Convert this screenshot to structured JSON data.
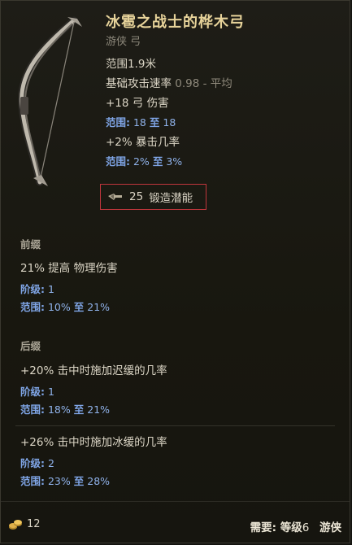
{
  "item": {
    "title": "冰雹之战士的桦木弓",
    "subtitle": "游侠 弓"
  },
  "stats": {
    "range": "范围1.9米",
    "speed_label": "基础攻击速率",
    "speed_value": "0.98 - 平均",
    "damage": "+18 弓 伤害",
    "damage_range": {
      "label": "范围:",
      "min": "18",
      "to": "至",
      "max": "18"
    },
    "crit": "+2% 暴击几率",
    "crit_range": {
      "label": "范围:",
      "min": "2%",
      "to": "至",
      "max": "3%"
    }
  },
  "forge": {
    "value": "25",
    "label": "锻造潜能",
    "icon": "forge-hammer-icon"
  },
  "prefix": {
    "header": "前缀",
    "affixes": [
      {
        "name": "21% 提高 物理伤害",
        "tier_label": "阶级:",
        "tier": "1",
        "range_label": "范围:",
        "min": "10%",
        "to": "至",
        "max": "21%"
      }
    ]
  },
  "suffix": {
    "header": "后缀",
    "affixes": [
      {
        "name": "+20% 击中时施加迟缓的几率",
        "tier_label": "阶级:",
        "tier": "1",
        "range_label": "范围:",
        "min": "18%",
        "to": "至",
        "max": "21%"
      },
      {
        "name": "+26% 击中时施加冰缓的几率",
        "tier_label": "阶级:",
        "tier": "2",
        "range_label": "范围:",
        "min": "23%",
        "to": "至",
        "max": "28%"
      }
    ]
  },
  "footer": {
    "gold": "12",
    "gold_icon": "gold-coins-icon",
    "req_label": "需要:",
    "level_label": "等级",
    "level": "6",
    "class": "游侠"
  },
  "colors": {
    "title": "#e7d39a",
    "range_blue": "#8ab0e8",
    "highlight_border": "#c0363c"
  }
}
